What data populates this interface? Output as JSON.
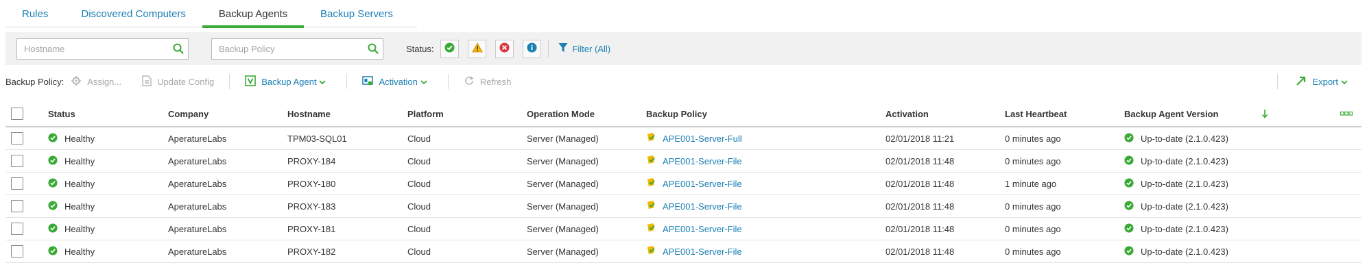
{
  "tabs": [
    {
      "label": "Rules"
    },
    {
      "label": "Discovered Computers"
    },
    {
      "label": "Backup Agents"
    },
    {
      "label": "Backup Servers"
    }
  ],
  "active_tab": "Backup Agents",
  "filters": {
    "hostname_placeholder": "Hostname",
    "policy_placeholder": "Backup Policy",
    "status_label": "Status:",
    "filter_label": "Filter (All)"
  },
  "toolbar": {
    "backup_policy_label": "Backup Policy:",
    "assign_label": "Assign...",
    "update_config_label": "Update Config",
    "backup_agent_label": "Backup Agent",
    "activation_label": "Activation",
    "refresh_label": "Refresh",
    "export_label": "Export"
  },
  "table": {
    "columns": [
      "Status",
      "Company",
      "Hostname",
      "Platform",
      "Operation Mode",
      "Backup Policy",
      "Activation",
      "Last Heartbeat",
      "Backup Agent Version"
    ],
    "rows": [
      {
        "status": "Healthy",
        "company": "AperatureLabs",
        "hostname": "TPM03-SQL01",
        "platform": "Cloud",
        "mode": "Server (Managed)",
        "policy": "APE001-Server-Full",
        "activation": "02/01/2018 11:21",
        "heartbeat": "0 minutes ago",
        "version": "Up-to-date (2.1.0.423)"
      },
      {
        "status": "Healthy",
        "company": "AperatureLabs",
        "hostname": "PROXY-184",
        "platform": "Cloud",
        "mode": "Server (Managed)",
        "policy": "APE001-Server-File",
        "activation": "02/01/2018 11:48",
        "heartbeat": "0 minutes ago",
        "version": "Up-to-date (2.1.0.423)"
      },
      {
        "status": "Healthy",
        "company": "AperatureLabs",
        "hostname": "PROXY-180",
        "platform": "Cloud",
        "mode": "Server (Managed)",
        "policy": "APE001-Server-File",
        "activation": "02/01/2018 11:48",
        "heartbeat": "1 minute ago",
        "version": "Up-to-date (2.1.0.423)"
      },
      {
        "status": "Healthy",
        "company": "AperatureLabs",
        "hostname": "PROXY-183",
        "platform": "Cloud",
        "mode": "Server (Managed)",
        "policy": "APE001-Server-File",
        "activation": "02/01/2018 11:48",
        "heartbeat": "0 minutes ago",
        "version": "Up-to-date (2.1.0.423)"
      },
      {
        "status": "Healthy",
        "company": "AperatureLabs",
        "hostname": "PROXY-181",
        "platform": "Cloud",
        "mode": "Server (Managed)",
        "policy": "APE001-Server-File",
        "activation": "02/01/2018 11:48",
        "heartbeat": "0 minutes ago",
        "version": "Up-to-date (2.1.0.423)"
      },
      {
        "status": "Healthy",
        "company": "AperatureLabs",
        "hostname": "PROXY-182",
        "platform": "Cloud",
        "mode": "Server (Managed)",
        "policy": "APE001-Server-File",
        "activation": "02/01/2018 11:48",
        "heartbeat": "0 minutes ago",
        "version": "Up-to-date (2.1.0.423)"
      }
    ]
  },
  "icons": {
    "search": "search-icon",
    "status_ok": "check-circle-icon",
    "status_warning": "warning-triangle-icon",
    "status_error": "error-x-icon",
    "status_info": "info-icon",
    "filter": "funnel-icon",
    "sort": "sort-down-arrow-icon",
    "columns": "column-chooser-icon",
    "policy": "policy-shield-icon"
  },
  "colors": {
    "accent_green": "#3aaa35",
    "link_blue": "#1a7fb4",
    "warning": "#e0a100",
    "error": "#d9363e",
    "info": "#1a7fb4"
  }
}
